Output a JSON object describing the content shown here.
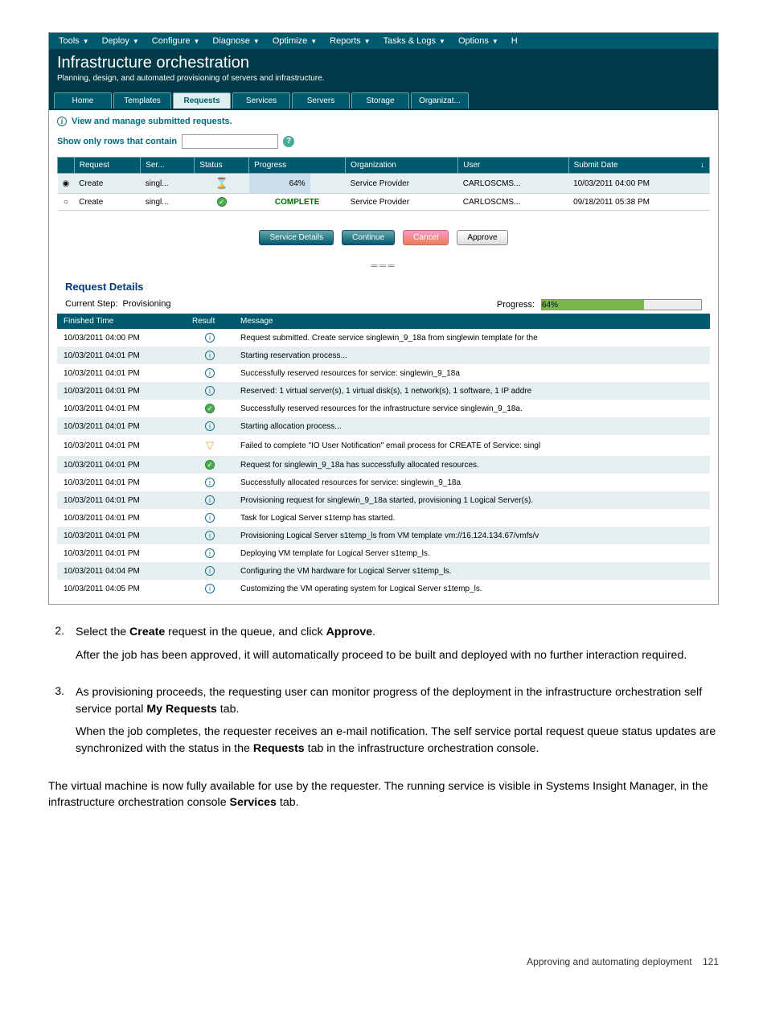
{
  "menubar": {
    "items": [
      "Tools",
      "Deploy",
      "Configure",
      "Diagnose",
      "Optimize",
      "Reports",
      "Tasks & Logs",
      "Options",
      "H"
    ]
  },
  "header": {
    "title": "Infrastructure orchestration",
    "subtitle": "Planning, design, and automated provisioning of servers and infrastructure."
  },
  "tabs": [
    "Home",
    "Templates",
    "Requests",
    "Services",
    "Servers",
    "Storage",
    "Organizat..."
  ],
  "active_tab_index": 2,
  "info_text": "View and manage submitted requests.",
  "filter_label": "Show only rows that contain",
  "req_headers": [
    "Request",
    "Ser...",
    "Status",
    "Progress",
    "Organization",
    "User",
    "Submit Date"
  ],
  "req_rows": [
    {
      "request": "Create",
      "ser": "singl...",
      "status": "hourglass",
      "progress": "64%",
      "org": "Service Provider",
      "user": "CARLOSCMS...",
      "date": "10/03/2011 04:00 PM",
      "selected": true
    },
    {
      "request": "Create",
      "ser": "singl...",
      "status": "success",
      "progress_complete": "COMPLETE",
      "org": "Service Provider",
      "user": "CARLOSCMS...",
      "date": "09/18/2011 05:38 PM",
      "selected": false
    }
  ],
  "buttons": {
    "service_details": "Service Details",
    "continue": "Continue",
    "cancel": "Cancel",
    "approve": "Approve"
  },
  "details": {
    "title": "Request Details",
    "step_label": "Current Step:",
    "step_value": "Provisioning",
    "progress_label": "Progress:",
    "progress_value": "64%"
  },
  "log_headers": [
    "Finished Time",
    "Result",
    "Message"
  ],
  "log_rows": [
    {
      "time": "10/03/2011 04:00 PM",
      "result": "info",
      "msg": "Request submitted. Create service singlewin_9_18a from singlewin template for the"
    },
    {
      "time": "10/03/2011 04:01 PM",
      "result": "info",
      "msg": "Starting reservation process..."
    },
    {
      "time": "10/03/2011 04:01 PM",
      "result": "info",
      "msg": "Successfully reserved resources for service: singlewin_9_18a"
    },
    {
      "time": "10/03/2011 04:01 PM",
      "result": "info",
      "msg": "Reserved: 1 virtual server(s), 1 virtual disk(s), 1 network(s), 1 software, 1 IP addre"
    },
    {
      "time": "10/03/2011 04:01 PM",
      "result": "success",
      "msg": "Successfully reserved resources for the infrastructure service singlewin_9_18a."
    },
    {
      "time": "10/03/2011 04:01 PM",
      "result": "info",
      "msg": "Starting allocation process..."
    },
    {
      "time": "10/03/2011 04:01 PM",
      "result": "warn",
      "msg": "Failed to complete \"IO User Notification\" email process for CREATE of Service: singl"
    },
    {
      "time": "10/03/2011 04:01 PM",
      "result": "success",
      "msg": "Request for singlewin_9_18a has successfully allocated resources."
    },
    {
      "time": "10/03/2011 04:01 PM",
      "result": "info",
      "msg": "Successfully allocated resources for service: singlewin_9_18a"
    },
    {
      "time": "10/03/2011 04:01 PM",
      "result": "info",
      "msg": "Provisioning request for singlewin_9_18a started, provisioning 1 Logical Server(s)."
    },
    {
      "time": "10/03/2011 04:01 PM",
      "result": "info",
      "msg": "Task for Logical Server s1temp has started."
    },
    {
      "time": "10/03/2011 04:01 PM",
      "result": "info",
      "msg": "Provisioning Logical Server s1temp_ls from VM template vm://16.124.134.67/vmfs/v"
    },
    {
      "time": "10/03/2011 04:01 PM",
      "result": "info",
      "msg": "Deploying VM template for Logical Server s1temp_ls."
    },
    {
      "time": "10/03/2011 04:04 PM",
      "result": "info",
      "msg": "Configuring the VM hardware for Logical Server s1temp_ls."
    },
    {
      "time": "10/03/2011 04:05 PM",
      "result": "info",
      "msg": "Customizing the VM operating system for Logical Server s1temp_ls."
    }
  ],
  "doc": {
    "step2_a": "Select the ",
    "step2_b": "Create",
    "step2_c": " request in the queue, and click ",
    "step2_d": "Approve",
    "step2_e": ".",
    "step2_f": "After the job has been approved, it will automatically proceed to be built and deployed with no further interaction required.",
    "step3_a": "As provisioning proceeds, the requesting user can monitor progress of the deployment in the infrastructure orchestration self service portal ",
    "step3_b": "My Requests",
    "step3_c": " tab.",
    "step3_d": "When the job completes, the requester receives an e-mail notification. The self service portal request queue status updates are synchronized with the status in the ",
    "step3_e": "Requests",
    "step3_f": " tab in the infrastructure orchestration console.",
    "para_a": "The virtual machine is now fully available for use by the requester. The running service is visible in Systems Insight Manager, in the infrastructure orchestration console ",
    "para_b": "Services",
    "para_c": " tab."
  },
  "footer": {
    "label": "Approving and automating deployment",
    "page": "121"
  }
}
